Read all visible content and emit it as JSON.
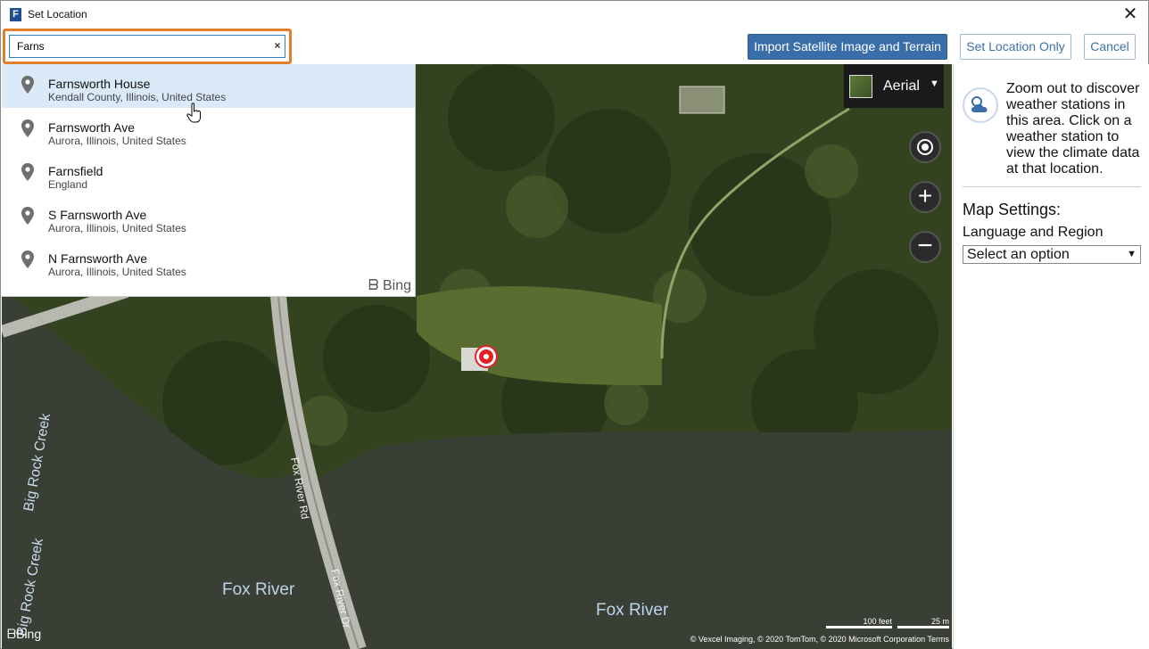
{
  "window": {
    "title": "Set Location",
    "app_icon_letter": "F"
  },
  "search": {
    "value": "Farns",
    "clear_symbol": "×"
  },
  "toolbar": {
    "import_label": "Import Satellite Image and Terrain",
    "set_location_label": "Set Location Only",
    "cancel_label": "Cancel"
  },
  "suggestions": [
    {
      "title": "Farnsworth House",
      "subtitle": "Kendall County, Illinois, United States",
      "selected": true
    },
    {
      "title": "Farnsworth Ave",
      "subtitle": "Aurora, Illinois, United States",
      "selected": false
    },
    {
      "title": "Farnsfield",
      "subtitle": "England",
      "selected": false
    },
    {
      "title": "S Farnsworth Ave",
      "subtitle": "Aurora, Illinois, United States",
      "selected": false
    },
    {
      "title": "N Farnsworth Ave",
      "subtitle": "Aurora, Illinois, United States",
      "selected": false
    }
  ],
  "dropdown_brand": "Bing",
  "map": {
    "style_label": "Aerial",
    "brand": "Bing",
    "labels": {
      "river_left": "Fox River",
      "river_right": "Fox River",
      "road_top": "Fox River Rd",
      "road_bottom": "Fox River Dr",
      "creek_top": "Big Rock Creek",
      "creek_bottom": "Big Rock Creek"
    },
    "scale_feet": "100 feet",
    "scale_m": "25 m",
    "copyright": "© Vexcel Imaging, © 2020 TomTom, © 2020 Microsoft Corporation  Terms",
    "zoom_in_symbol": "+",
    "zoom_out_symbol": "−"
  },
  "panel": {
    "weather_text": "Zoom out to discover weather stations in this area. Click on a weather station to view the climate data at that location.",
    "map_settings_label": "Map Settings:",
    "language_label": "Language and Region",
    "language_select_value": "Select an option"
  },
  "colors": {
    "accent": "#3a6ea8",
    "focus_outline": "#e0812a",
    "pin": "#e21e26",
    "selected_row": "#dbeaf8"
  }
}
